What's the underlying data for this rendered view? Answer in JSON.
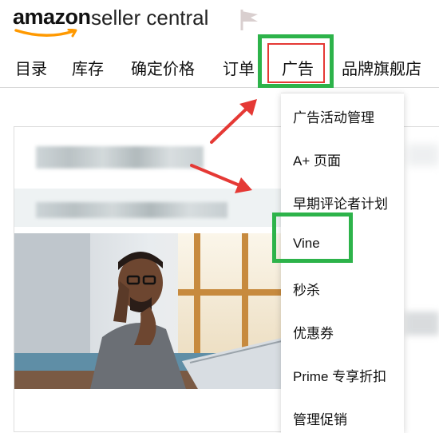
{
  "brand": {
    "logo_word": "amazon",
    "product_name": "seller central"
  },
  "nav": {
    "items": [
      "目录",
      "库存",
      "确定价格",
      "订单",
      "广告",
      "品牌旗舰店"
    ],
    "active_index": 4
  },
  "dropdown": {
    "items": [
      "广告活动管理",
      "A+ 页面",
      "早期评论者计划",
      "Vine",
      "秒杀",
      "优惠券",
      "Prime 专享折扣",
      "管理促销"
    ],
    "highlighted_index": 3
  },
  "colors": {
    "highlight_green": "#2db34a",
    "arrow_red": "#e53935",
    "smile_orange": "#ff9900"
  },
  "icons": [
    "flag-icon"
  ]
}
